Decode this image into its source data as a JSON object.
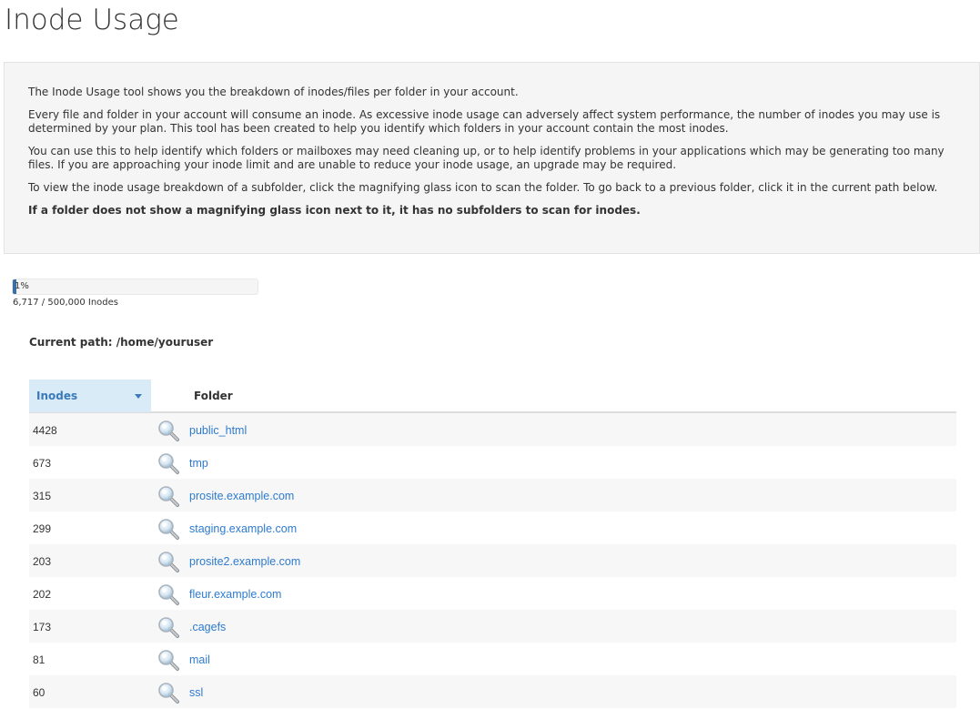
{
  "page": {
    "title": "Inode Usage"
  },
  "info": {
    "p1": "The Inode Usage tool shows you the breakdown of inodes/files per folder in your account.",
    "p2": "Every file and folder in your account will consume an inode. As excessive inode usage can adversely affect system performance, the number of inodes you may use is determined by your plan. This tool has been created to help you identify which folders in your account contain the most inodes.",
    "p3": "You can use this to help identify which folders or mailboxes may need cleaning up, or to help identify problems in your applications which may be generating too many files. If you are approaching your inode limit and are unable to reduce your inode usage, an upgrade may be required.",
    "p4": "To view the inode usage breakdown of a subfolder, click the magnifying glass icon to scan the folder. To go back to a previous folder, click it in the current path below.",
    "p5": "If a folder does not show a magnifying glass icon next to it, it has no subfolders to scan for inodes."
  },
  "usage": {
    "percent_label": "1%",
    "fraction": 0.013434,
    "count_label": "6,717 / 500,000 Inodes",
    "bar_color": "#3a6ea5"
  },
  "path": {
    "label": "Current path:",
    "value": "/home/youruser"
  },
  "table": {
    "headers": {
      "inodes": "Inodes",
      "folder": "Folder"
    },
    "sort_icon": "caret-down-icon",
    "rows": [
      {
        "inodes": "4428",
        "folder": "public_html"
      },
      {
        "inodes": "673",
        "folder": "tmp"
      },
      {
        "inodes": "315",
        "folder": "prosite.example.com"
      },
      {
        "inodes": "299",
        "folder": "staging.example.com"
      },
      {
        "inodes": "203",
        "folder": "prosite2.example.com"
      },
      {
        "inodes": "202",
        "folder": "fleur.example.com"
      },
      {
        "inodes": "173",
        "folder": ".cagefs"
      },
      {
        "inodes": "81",
        "folder": "mail"
      },
      {
        "inodes": "60",
        "folder": "ssl"
      }
    ]
  },
  "colors": {
    "link": "#2e7bcf",
    "header_active_bg": "#d9ebf7",
    "header_active_text": "#3a7ab8"
  }
}
